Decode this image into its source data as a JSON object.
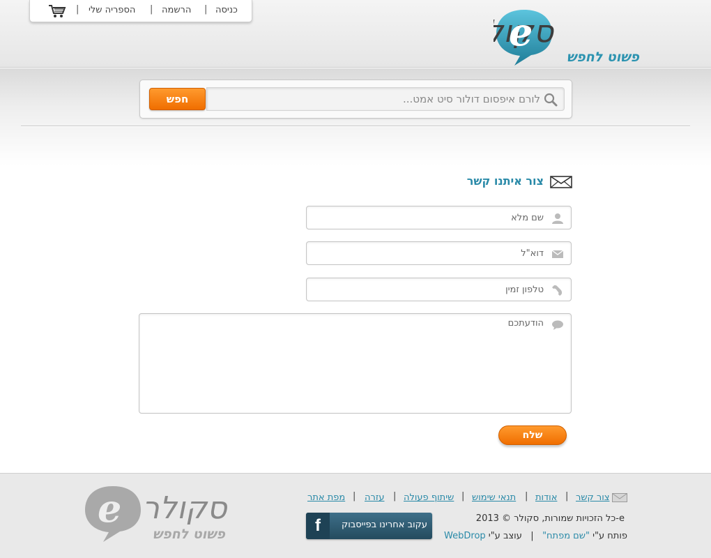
{
  "header": {
    "nav": {
      "login": "כניסה",
      "register": "הרשמה",
      "my_library": "הספריה שלי",
      "separator": "|"
    },
    "logo": {
      "main": "סקולר",
      "letter": "e",
      "tagline": "פשוט לחפש"
    }
  },
  "search": {
    "placeholder": "לורם איפסום דולור סיט אמט...",
    "button_label": "חפש"
  },
  "contact": {
    "title": "צור איתנו קשר",
    "fields": {
      "full_name": "שם מלא",
      "email": "דוא\"ל",
      "phone": "טלפון זמין",
      "message": "הודעתכם"
    },
    "send_label": "שלח"
  },
  "footer": {
    "links": {
      "contact": "צור קשר",
      "about": "אודות",
      "terms": "תנאי שימוש",
      "partnership": "שיתוף פעולה",
      "help": "עזרה",
      "sitemap": "מפת אתר"
    },
    "separator": "|",
    "copyright": "2013 © כל הזכויות שמורות, סקולר-e",
    "credit": {
      "developed_by": "פותח ע\"י",
      "developer": "\"שם מפתח\"",
      "divider": "|",
      "designed_by": "עוצב ע\"י",
      "designer": "WebDrop"
    },
    "facebook": {
      "label": "עקוב אחרינו בפייסבוק",
      "icon_letter": "f"
    },
    "logo": {
      "main": "סקולר",
      "letter": "e",
      "tagline": "פשוט לחפש"
    }
  },
  "colors": {
    "accent": "#2a8aa8",
    "orange": "#f07a10",
    "logo_teal": "#2b93b0"
  }
}
